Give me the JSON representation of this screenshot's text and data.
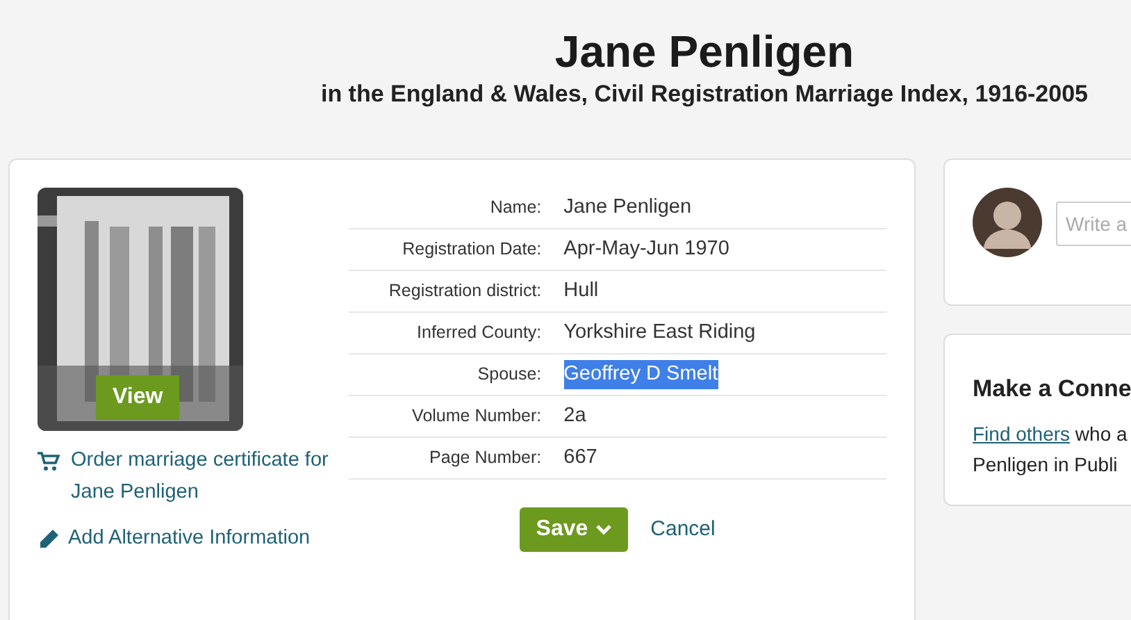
{
  "header": {
    "title": "Jane Penligen",
    "subtitle": "in the England & Wales, Civil Registration Marriage Index, 1916-2005"
  },
  "record": {
    "image_button": "View",
    "links": [
      {
        "kind": "cart",
        "text": "Order marriage certificate for Jane Penligen"
      },
      {
        "kind": "pencil",
        "text": "Add Alternative Information"
      }
    ],
    "fields": [
      {
        "label": "Name:",
        "value": "Jane Penligen",
        "selected": false
      },
      {
        "label": "Registration Date:",
        "value": "Apr-May-Jun 1970",
        "selected": false
      },
      {
        "label": "Registration district:",
        "value": "Hull",
        "selected": false
      },
      {
        "label": "Inferred County:",
        "value": "Yorkshire East Riding",
        "selected": false
      },
      {
        "label": "Spouse:",
        "value": "Geoffrey D Smelt",
        "selected": true
      },
      {
        "label": "Volume Number:",
        "value": "2a",
        "selected": false
      },
      {
        "label": "Page Number:",
        "value": "667",
        "selected": false
      }
    ],
    "save": "Save",
    "cancel": "Cancel"
  },
  "comment": {
    "placeholder": "Write a"
  },
  "connect": {
    "title": "Make a Conne",
    "link": "Find others",
    "line_1_rest": " who a",
    "line_2": "Penligen in Publi"
  }
}
